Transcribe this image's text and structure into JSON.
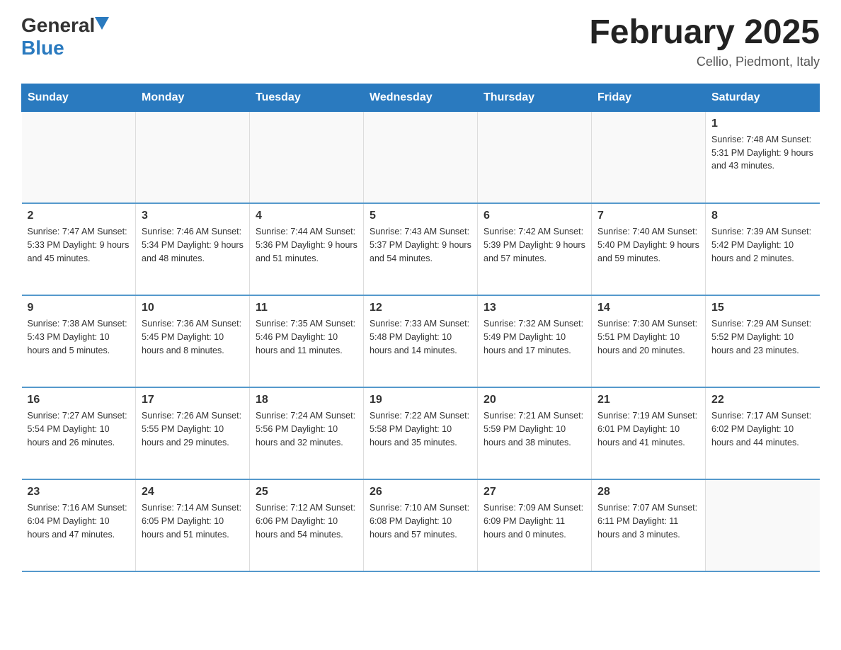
{
  "header": {
    "logo_general": "General",
    "logo_blue": "Blue",
    "month_title": "February 2025",
    "subtitle": "Cellio, Piedmont, Italy"
  },
  "days_of_week": [
    "Sunday",
    "Monday",
    "Tuesday",
    "Wednesday",
    "Thursday",
    "Friday",
    "Saturday"
  ],
  "weeks": [
    [
      {
        "day": "",
        "info": ""
      },
      {
        "day": "",
        "info": ""
      },
      {
        "day": "",
        "info": ""
      },
      {
        "day": "",
        "info": ""
      },
      {
        "day": "",
        "info": ""
      },
      {
        "day": "",
        "info": ""
      },
      {
        "day": "1",
        "info": "Sunrise: 7:48 AM\nSunset: 5:31 PM\nDaylight: 9 hours and 43 minutes."
      }
    ],
    [
      {
        "day": "2",
        "info": "Sunrise: 7:47 AM\nSunset: 5:33 PM\nDaylight: 9 hours and 45 minutes."
      },
      {
        "day": "3",
        "info": "Sunrise: 7:46 AM\nSunset: 5:34 PM\nDaylight: 9 hours and 48 minutes."
      },
      {
        "day": "4",
        "info": "Sunrise: 7:44 AM\nSunset: 5:36 PM\nDaylight: 9 hours and 51 minutes."
      },
      {
        "day": "5",
        "info": "Sunrise: 7:43 AM\nSunset: 5:37 PM\nDaylight: 9 hours and 54 minutes."
      },
      {
        "day": "6",
        "info": "Sunrise: 7:42 AM\nSunset: 5:39 PM\nDaylight: 9 hours and 57 minutes."
      },
      {
        "day": "7",
        "info": "Sunrise: 7:40 AM\nSunset: 5:40 PM\nDaylight: 9 hours and 59 minutes."
      },
      {
        "day": "8",
        "info": "Sunrise: 7:39 AM\nSunset: 5:42 PM\nDaylight: 10 hours and 2 minutes."
      }
    ],
    [
      {
        "day": "9",
        "info": "Sunrise: 7:38 AM\nSunset: 5:43 PM\nDaylight: 10 hours and 5 minutes."
      },
      {
        "day": "10",
        "info": "Sunrise: 7:36 AM\nSunset: 5:45 PM\nDaylight: 10 hours and 8 minutes."
      },
      {
        "day": "11",
        "info": "Sunrise: 7:35 AM\nSunset: 5:46 PM\nDaylight: 10 hours and 11 minutes."
      },
      {
        "day": "12",
        "info": "Sunrise: 7:33 AM\nSunset: 5:48 PM\nDaylight: 10 hours and 14 minutes."
      },
      {
        "day": "13",
        "info": "Sunrise: 7:32 AM\nSunset: 5:49 PM\nDaylight: 10 hours and 17 minutes."
      },
      {
        "day": "14",
        "info": "Sunrise: 7:30 AM\nSunset: 5:51 PM\nDaylight: 10 hours and 20 minutes."
      },
      {
        "day": "15",
        "info": "Sunrise: 7:29 AM\nSunset: 5:52 PM\nDaylight: 10 hours and 23 minutes."
      }
    ],
    [
      {
        "day": "16",
        "info": "Sunrise: 7:27 AM\nSunset: 5:54 PM\nDaylight: 10 hours and 26 minutes."
      },
      {
        "day": "17",
        "info": "Sunrise: 7:26 AM\nSunset: 5:55 PM\nDaylight: 10 hours and 29 minutes."
      },
      {
        "day": "18",
        "info": "Sunrise: 7:24 AM\nSunset: 5:56 PM\nDaylight: 10 hours and 32 minutes."
      },
      {
        "day": "19",
        "info": "Sunrise: 7:22 AM\nSunset: 5:58 PM\nDaylight: 10 hours and 35 minutes."
      },
      {
        "day": "20",
        "info": "Sunrise: 7:21 AM\nSunset: 5:59 PM\nDaylight: 10 hours and 38 minutes."
      },
      {
        "day": "21",
        "info": "Sunrise: 7:19 AM\nSunset: 6:01 PM\nDaylight: 10 hours and 41 minutes."
      },
      {
        "day": "22",
        "info": "Sunrise: 7:17 AM\nSunset: 6:02 PM\nDaylight: 10 hours and 44 minutes."
      }
    ],
    [
      {
        "day": "23",
        "info": "Sunrise: 7:16 AM\nSunset: 6:04 PM\nDaylight: 10 hours and 47 minutes."
      },
      {
        "day": "24",
        "info": "Sunrise: 7:14 AM\nSunset: 6:05 PM\nDaylight: 10 hours and 51 minutes."
      },
      {
        "day": "25",
        "info": "Sunrise: 7:12 AM\nSunset: 6:06 PM\nDaylight: 10 hours and 54 minutes."
      },
      {
        "day": "26",
        "info": "Sunrise: 7:10 AM\nSunset: 6:08 PM\nDaylight: 10 hours and 57 minutes."
      },
      {
        "day": "27",
        "info": "Sunrise: 7:09 AM\nSunset: 6:09 PM\nDaylight: 11 hours and 0 minutes."
      },
      {
        "day": "28",
        "info": "Sunrise: 7:07 AM\nSunset: 6:11 PM\nDaylight: 11 hours and 3 minutes."
      },
      {
        "day": "",
        "info": ""
      }
    ]
  ]
}
